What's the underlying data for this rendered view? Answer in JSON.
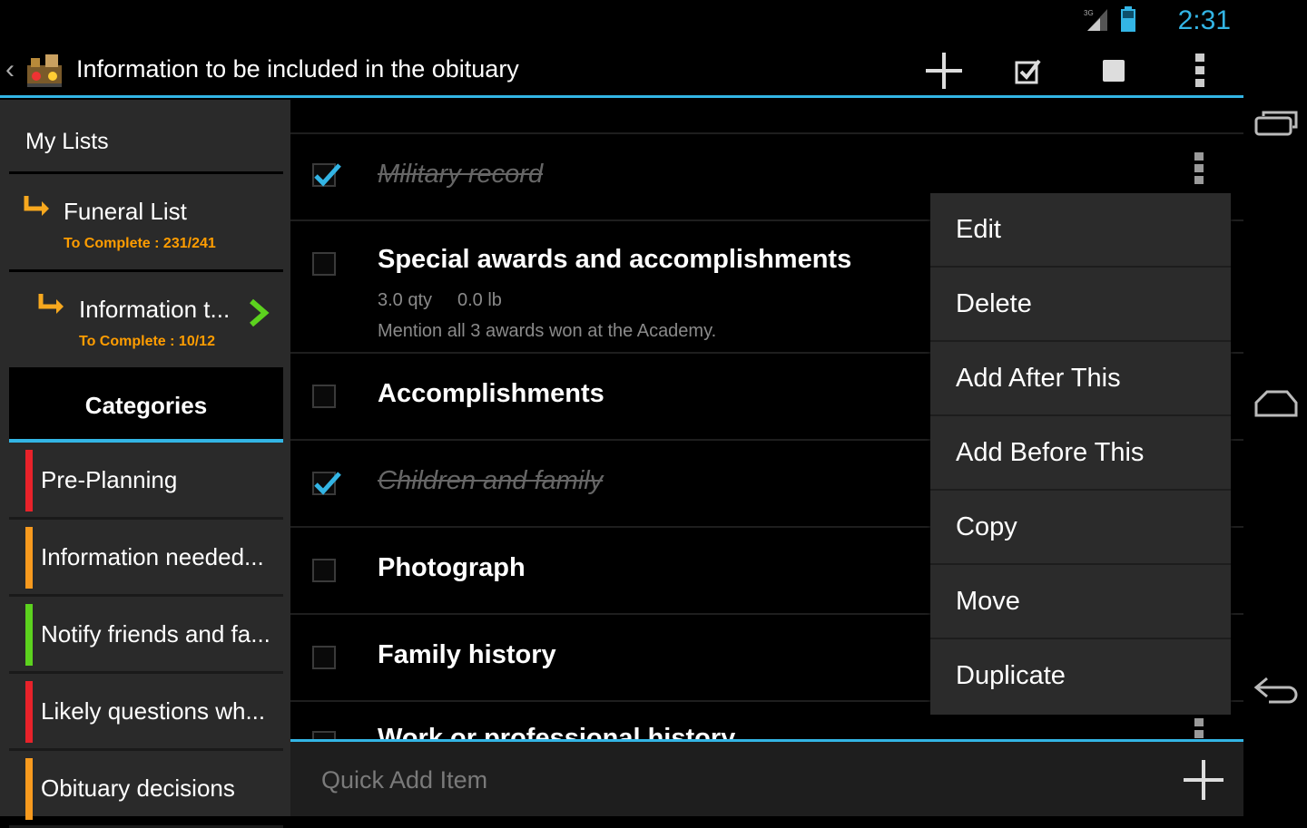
{
  "status_bar": {
    "time": "2:31",
    "network": "3G"
  },
  "action_bar": {
    "title": "Information to be included in the obituary",
    "icons": [
      "back-chevron-icon",
      "app-logo-icon",
      "add-icon",
      "check-all-icon",
      "uncheck-all-icon",
      "overflow-menu-icon"
    ]
  },
  "sidebar": {
    "my_lists_label": "My Lists",
    "lists": [
      {
        "name": "Funeral List",
        "progress": "To Complete : 231/241"
      },
      {
        "name": "Information t...",
        "progress": "To Complete : 10/12",
        "selected": true
      }
    ],
    "categories_label": "Categories",
    "categories": [
      {
        "label": "Pre-Planning",
        "color": "#e8222a"
      },
      {
        "label": "Information needed...",
        "color": "#f79a1e"
      },
      {
        "label": "Notify friends and fa...",
        "color": "#5cd21e"
      },
      {
        "label": "Likely questions wh...",
        "color": "#e8222a"
      },
      {
        "label": "Obituary decisions",
        "color": "#f79a1e"
      }
    ]
  },
  "items": [
    {
      "title": "Military record",
      "checked": true
    },
    {
      "title": "Special awards and accomplishments",
      "checked": false,
      "qty": "3.0 qty",
      "weight": "0.0 lb",
      "note": "Mention all 3 awards won at the Academy."
    },
    {
      "title": "Accomplishments",
      "checked": false
    },
    {
      "title": "Children and family",
      "checked": true
    },
    {
      "title": "Photograph",
      "checked": false
    },
    {
      "title": "Family history",
      "checked": false
    },
    {
      "title": "Work or professional history",
      "checked": false
    }
  ],
  "popup_menu": {
    "items": [
      "Edit",
      "Delete",
      "Add After This",
      "Add Before This",
      "Copy",
      "Move",
      "Duplicate"
    ]
  },
  "quick_add": {
    "placeholder": "Quick Add Item"
  },
  "nav_bar": {
    "icons": [
      "recent-apps-icon",
      "home-icon",
      "back-icon"
    ]
  },
  "colors": {
    "accent": "#33b5e5",
    "progress_text": "#ff9d00",
    "check": "#33b5e5"
  }
}
